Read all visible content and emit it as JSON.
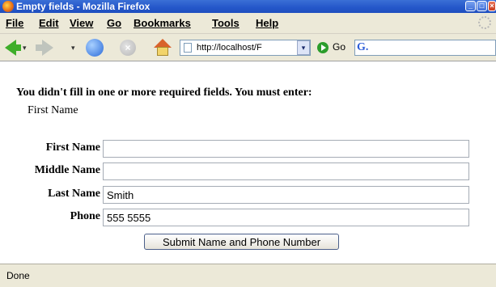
{
  "window": {
    "title": "Empty fields - Mozilla Firefox",
    "controls": {
      "minimize": "_",
      "maximize": "□",
      "close": "×"
    }
  },
  "menubar": {
    "items": [
      {
        "label": "File"
      },
      {
        "label": "Edit"
      },
      {
        "label": "View"
      },
      {
        "label": "Go"
      },
      {
        "label": "Bookmarks"
      },
      {
        "label": "Tools"
      },
      {
        "label": "Help"
      }
    ]
  },
  "toolbar": {
    "icons": [
      "back-arrow-icon",
      "forward-arrow-icon",
      "reload-icon",
      "stop-icon",
      "home-icon"
    ],
    "url": "http://localhost/F",
    "go_label": "Go",
    "search_engine": "G."
  },
  "content": {
    "error_message": "You didn't fill in one or more required fields. You must enter:",
    "missing_fields": [
      "First Name"
    ],
    "form": {
      "fields": [
        {
          "label": "First Name",
          "value": ""
        },
        {
          "label": "Middle Name",
          "value": ""
        },
        {
          "label": "Last Name",
          "value": "Smith"
        },
        {
          "label": "Phone",
          "value": "555 5555"
        }
      ],
      "submit_label": "Submit Name and Phone Number"
    }
  },
  "statusbar": {
    "text": "Done"
  },
  "colors": {
    "titlebar": "#2456c9",
    "chrome": "#ece9d8",
    "go_button": "#2b9d2b"
  }
}
